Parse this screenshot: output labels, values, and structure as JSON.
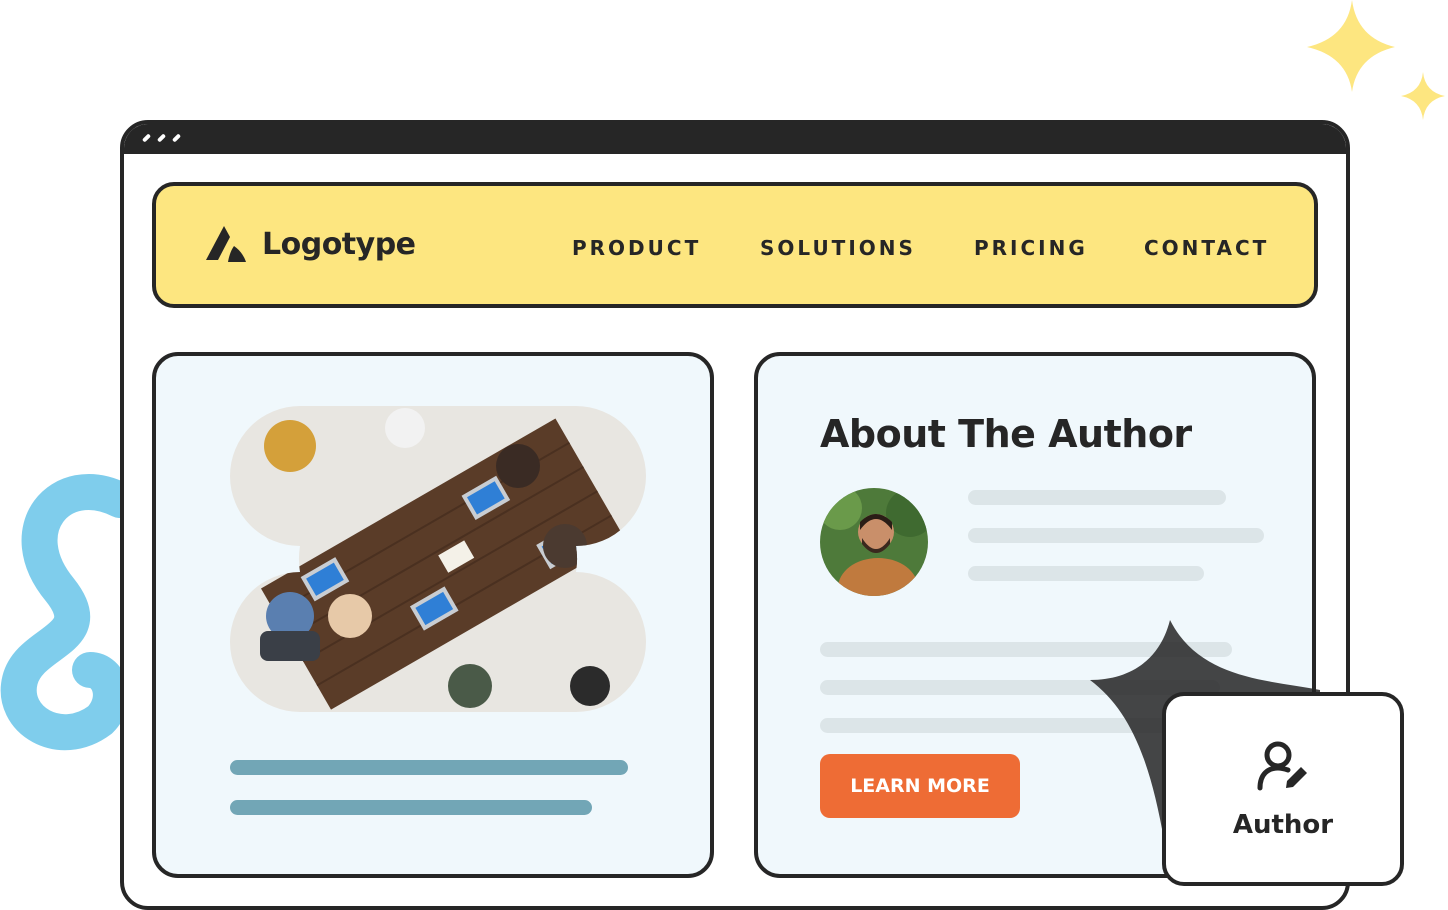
{
  "nav": {
    "logo_text": "Logotype",
    "items": [
      {
        "label": "PRODUCT"
      },
      {
        "label": "SOLUTIONS"
      },
      {
        "label": "PRICING"
      },
      {
        "label": "CONTACT"
      }
    ]
  },
  "author_section": {
    "title": "About The Author",
    "button_label": "LEARN MORE"
  },
  "author_badge": {
    "label": "Author",
    "icon": "user-edit-icon"
  },
  "colors": {
    "nav_bg": "#fde680",
    "card_bg": "#f0f8fc",
    "outline": "#262626",
    "accent_button": "#ee6c35",
    "placeholder_dark": "#72a6b6",
    "placeholder_light": "#dce5e8",
    "sparkle": "#fde680",
    "squiggle": "#7fcdec"
  }
}
